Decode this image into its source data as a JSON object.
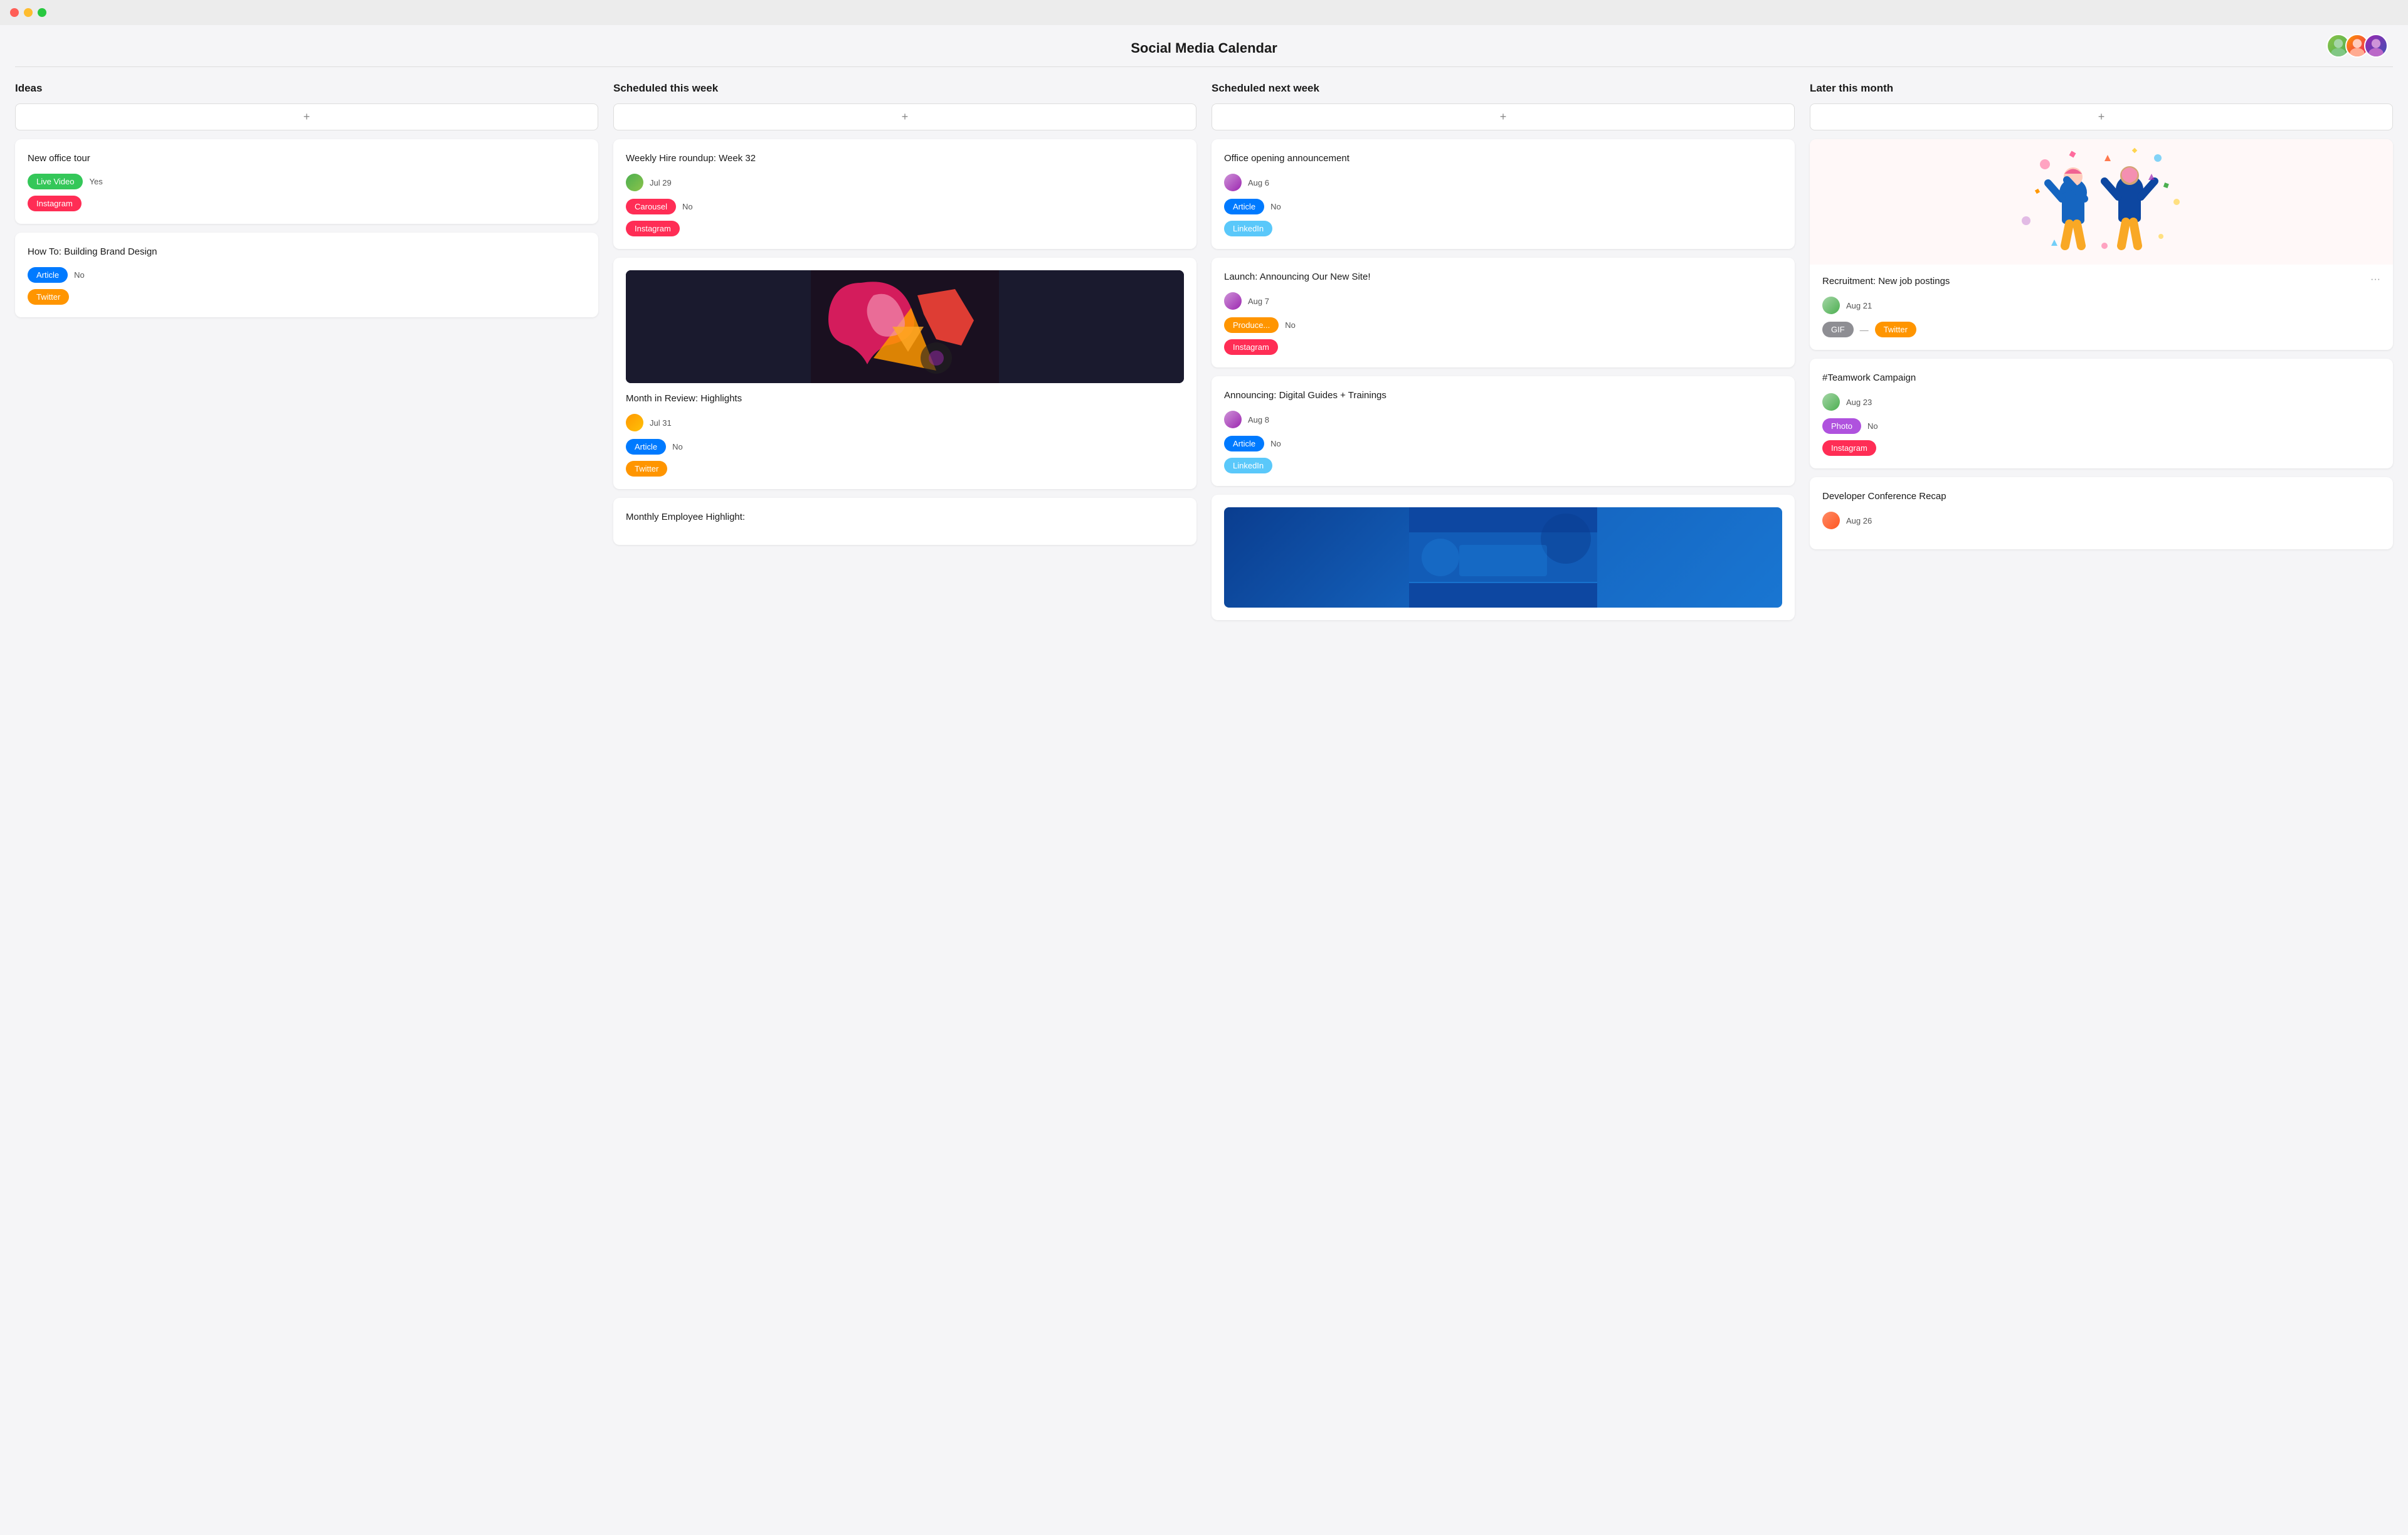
{
  "app": {
    "title": "Social Media Calendar"
  },
  "header": {
    "title": "Social Media Calendar",
    "avatars": [
      {
        "id": "avatar-1",
        "color": "avatar-1"
      },
      {
        "id": "avatar-2",
        "color": "avatar-2"
      },
      {
        "id": "avatar-3",
        "color": "avatar-3"
      }
    ]
  },
  "columns": [
    {
      "id": "ideas",
      "label": "Ideas",
      "add_label": "+",
      "cards": [
        {
          "id": "new-office-tour",
          "title": "New office tour",
          "type_tag": {
            "label": "Live Video",
            "class": "tag-green"
          },
          "type_value": "Yes",
          "platform_tag": {
            "label": "Instagram",
            "class": "tag-pink"
          }
        },
        {
          "id": "brand-design",
          "title": "How To: Building Brand Design",
          "type_tag": {
            "label": "Article",
            "class": "tag-blue"
          },
          "type_value": "No",
          "platform_tag": {
            "label": "Twitter",
            "class": "tag-orange"
          }
        }
      ]
    },
    {
      "id": "scheduled-this-week",
      "label": "Scheduled this week",
      "add_label": "+",
      "cards": [
        {
          "id": "weekly-hire",
          "title": "Weekly Hire roundup: Week 32",
          "avatar_color": "#4caf50",
          "date": "Jul 29",
          "type_tag": {
            "label": "Carousel",
            "class": "tag-pink"
          },
          "type_value": "No",
          "platform_tag": {
            "label": "Instagram",
            "class": "tag-pink"
          },
          "has_image": false
        },
        {
          "id": "month-review",
          "title": "Month in Review: Highlights",
          "avatar_color": "#ff9800",
          "date": "Jul 31",
          "type_tag": {
            "label": "Article",
            "class": "tag-blue"
          },
          "type_value": "No",
          "platform_tag": {
            "label": "Twitter",
            "class": "tag-orange"
          },
          "has_image": true
        },
        {
          "id": "monthly-employee",
          "title": "Monthly Employee Highlight:",
          "has_image": false
        }
      ]
    },
    {
      "id": "scheduled-next-week",
      "label": "Scheduled next week",
      "add_label": "+",
      "cards": [
        {
          "id": "office-opening",
          "title": "Office opening announcement",
          "avatar_color": "#9c27b0",
          "date": "Aug 6",
          "type_tag": {
            "label": "Article",
            "class": "tag-blue"
          },
          "type_value": "No",
          "platform_tag": {
            "label": "LinkedIn",
            "class": "tag-teal"
          }
        },
        {
          "id": "new-site",
          "title": "Launch: Announcing Our New Site!",
          "avatar_color": "#9c27b0",
          "date": "Aug 7",
          "type_tag": {
            "label": "Produce...",
            "class": "tag-orange"
          },
          "type_value": "No",
          "platform_tag": {
            "label": "Instagram",
            "class": "tag-pink"
          }
        },
        {
          "id": "digital-guides",
          "title": "Announcing: Digital Guides + Trainings",
          "avatar_color": "#9c27b0",
          "date": "Aug 8",
          "type_tag": {
            "label": "Article",
            "class": "tag-blue"
          },
          "type_value": "No",
          "platform_tag": {
            "label": "LinkedIn",
            "class": "tag-teal"
          },
          "has_image": false
        }
      ]
    },
    {
      "id": "later-this-month",
      "label": "Later this month",
      "add_label": "+",
      "cards": [
        {
          "id": "recruitment",
          "title": "Recruitment: New job postings",
          "avatar_color": "#4caf50",
          "date": "Aug 21",
          "type_tag": {
            "label": "GIF",
            "class": "tag-gray"
          },
          "platform_tag": {
            "label": "Twitter",
            "class": "tag-orange"
          },
          "has_artwork": true
        },
        {
          "id": "teamwork",
          "title": "#Teamwork Campaign",
          "avatar_color": "#4caf50",
          "date": "Aug 23",
          "type_tag": {
            "label": "Photo",
            "class": "tag-purple"
          },
          "type_value": "No",
          "platform_tag": {
            "label": "Instagram",
            "class": "tag-pink"
          }
        },
        {
          "id": "dev-conference",
          "title": "Developer Conference Recap",
          "avatar_color": "#ff5722",
          "date": "Aug 26"
        }
      ]
    }
  ]
}
